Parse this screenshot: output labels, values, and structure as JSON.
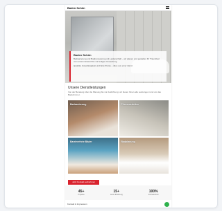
{
  "header": {
    "brand": "Baden Schön",
    "menu_icon": "hamburger-icon"
  },
  "hero": {
    "title": "Baden Schön",
    "text1": "Badsanierung und Badrenovierung mit Leidenschaft – wir planen und gestalten Ihr Traumbad vom ersten Entwurf bis zur fertigen Umsetzung.",
    "text2": "Qualität, Zuverlässigkeit und faire Preise – alles aus einer Hand."
  },
  "services": {
    "heading": "Unsere Dienstleistungen",
    "intro": "Von der Beratung über die Planung bis zur Ausführung: wir bieten Ihnen alle Leistungen rund um das Badezimmer.",
    "items": [
      {
        "label": "Badsanierung"
      },
      {
        "label": "Fliesenarbeiten"
      },
      {
        "label": "Barrierefreie Bäder"
      },
      {
        "label": "Badplanung"
      }
    ]
  },
  "cta": {
    "label": "Jetzt Kontakt aufnehmen"
  },
  "stats": [
    {
      "num": "45+",
      "cap": "Projekte"
    },
    {
      "num": "15+",
      "cap": "Jahre Erfahrung"
    },
    {
      "num": "100%",
      "cap": "Zufriedenheit"
    }
  ],
  "footer": {
    "text": "Kontakt & Impressum",
    "chat_icon": "whatsapp-icon"
  },
  "colors": {
    "accent": "#d9232e",
    "chat": "#2fb24d"
  }
}
